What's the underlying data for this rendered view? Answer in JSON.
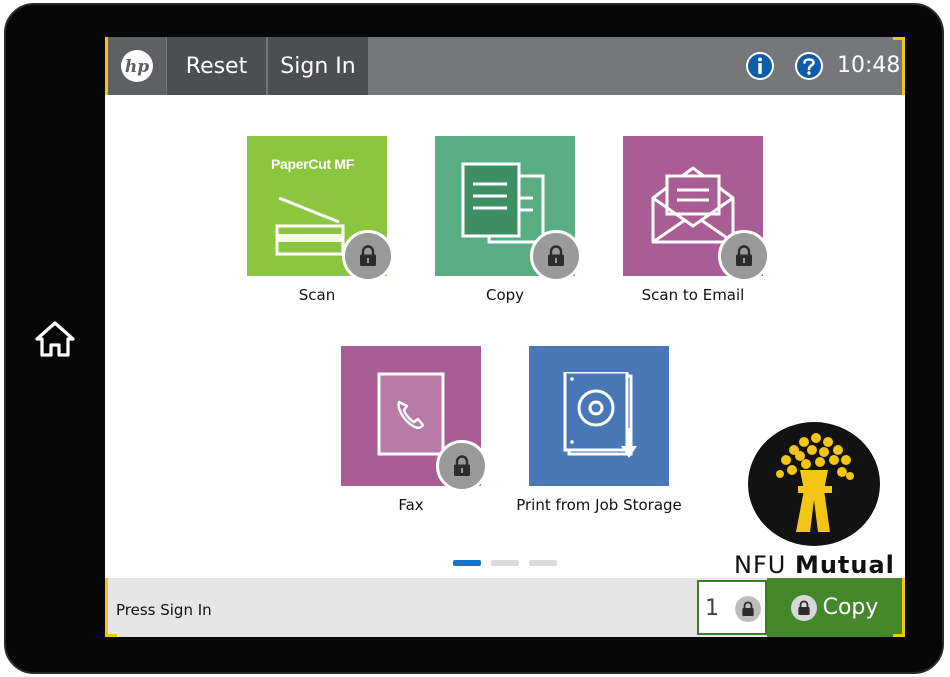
{
  "topbar": {
    "logo_text": "hp",
    "reset_label": "Reset",
    "signin_label": "Sign In",
    "time": "10:48"
  },
  "tiles": [
    {
      "label": "Scan",
      "color": "#8cc63f",
      "brand": "PaperCut MF",
      "locked": true
    },
    {
      "label": "Copy",
      "color": "#58ae82",
      "locked": true
    },
    {
      "label": "Scan to Email",
      "color": "#a85e95",
      "locked": true
    },
    {
      "label": "Fax",
      "color": "#a85e95",
      "locked": true
    },
    {
      "label": "Print from Job Storage",
      "color": "#4a78b7",
      "locked": false
    }
  ],
  "pager": {
    "pages": 3,
    "active": 0
  },
  "logo": {
    "brand_light": "NFU ",
    "brand_bold": "Mutual"
  },
  "bottombar": {
    "status": "Press Sign In",
    "copies": "1",
    "copy_label": "Copy"
  },
  "colors": {
    "accent": "#f2c516",
    "copy_button": "#45872b",
    "active_dot": "#1a73c7"
  }
}
